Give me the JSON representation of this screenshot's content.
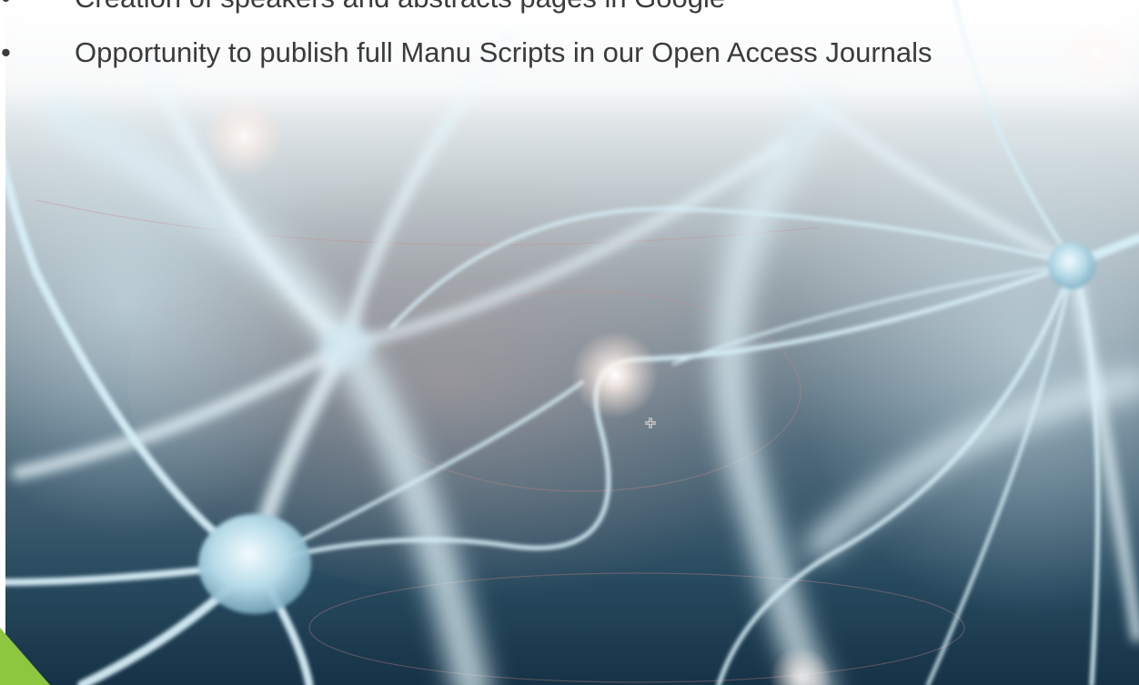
{
  "slide": {
    "bullets": [
      {
        "marker": "•",
        "text": "Creation of speakers and abstracts pages in Google"
      },
      {
        "marker": "•",
        "text": "Opportunity to publish full Manu Scripts in our Open Access Journals"
      }
    ],
    "background_image": "neuron-network-photo",
    "cursor_icon": "crosshair-cursor-icon",
    "colors": {
      "text": "#3b3b3b",
      "accent": "#8dc63f",
      "background_dark": "#143247",
      "neuron_light": "#cfe8f2"
    }
  }
}
